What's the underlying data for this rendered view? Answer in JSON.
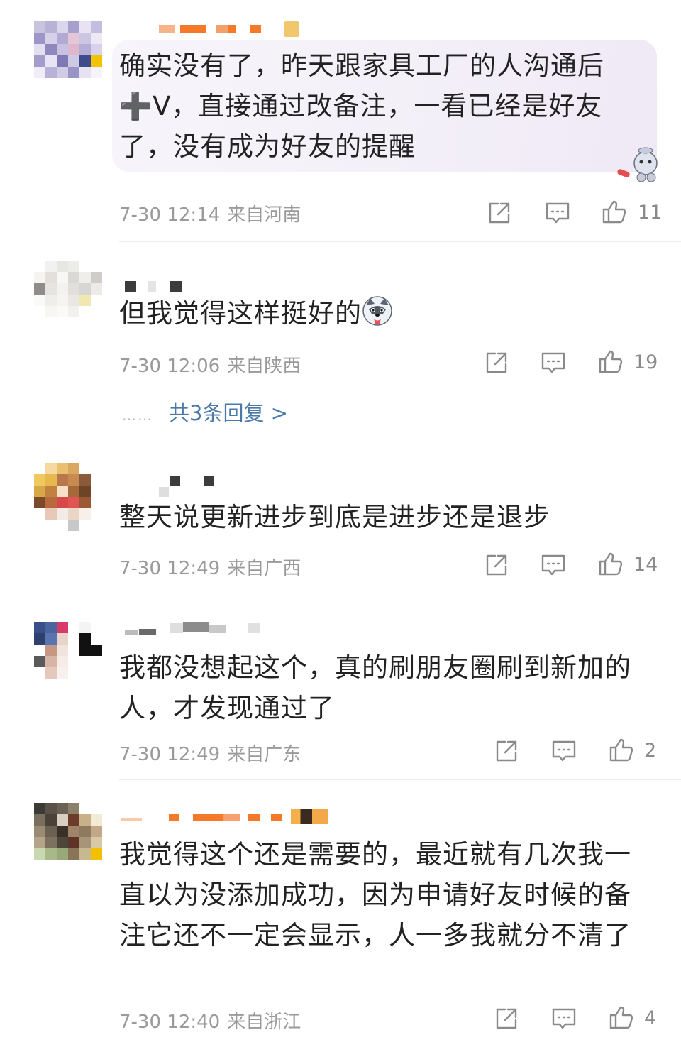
{
  "comments": [
    {
      "text": "确实没有了，昨天跟家具工厂的人沟通后➕V，直接通过改备注，一看已经是好友了，没有成为好友的提醒",
      "date": "7-30 12:14",
      "location": "来自河南",
      "likes": "11"
    },
    {
      "text": "但我觉得这样挺好的",
      "date": "7-30 12:06",
      "location": "来自陕西",
      "likes": "19",
      "replies": "共3条回复 >"
    },
    {
      "text": "整天说更新进步到底是进步还是退步",
      "date": "7-30 12:49",
      "location": "来自广西",
      "likes": "14"
    },
    {
      "text": "我都没想起这个，真的刷朋友圈刷到新加的人，才发现通过了",
      "date": "7-30 12:49",
      "location": "来自广东",
      "likes": "2"
    },
    {
      "text": "我觉得这个还是需要的，最近就有几次我一直以为没添加成功，因为申请好友时候的备注它还不一定会显示，人一多我就分不清了",
      "date": "7-30 12:40",
      "location": "来自浙江",
      "likes": "4"
    }
  ],
  "reply_dots": "……",
  "colors": {
    "text": "#222222",
    "meta": "#9a9a9a",
    "link": "#4a79a8",
    "bubble": "#f3eff8"
  },
  "icons": [
    "share-icon",
    "comment-icon",
    "like-icon"
  ]
}
